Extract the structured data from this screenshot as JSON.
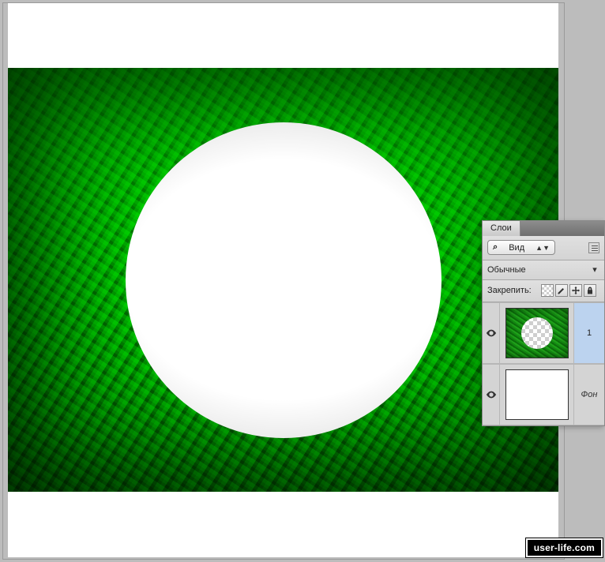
{
  "panel": {
    "tab_layers": "Слои",
    "view_dropdown": "Вид",
    "blend_mode": "Обычные",
    "lock_label": "Закрепить:"
  },
  "layers": [
    {
      "name": "1",
      "visible": true,
      "selected": true,
      "kind": "grass-hole"
    },
    {
      "name": "Фон",
      "visible": true,
      "selected": false,
      "kind": "white"
    }
  ],
  "watermark": "user-life.com"
}
